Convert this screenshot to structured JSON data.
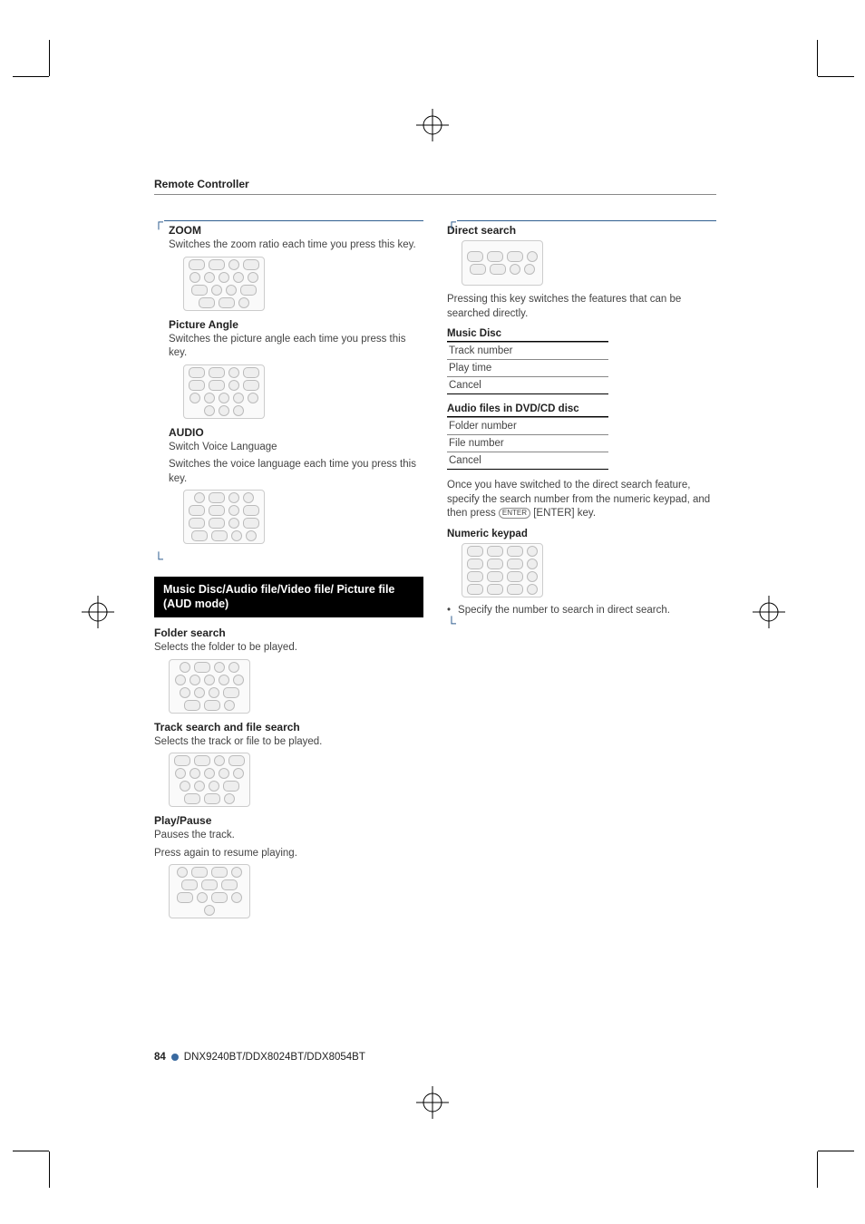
{
  "header": {
    "title": "Remote Controller"
  },
  "left": {
    "zoom": {
      "heading": "ZOOM",
      "desc": "Switches the zoom ratio each time you press this key."
    },
    "pictureAngle": {
      "heading": "Picture Angle",
      "desc": "Switches the picture angle each time you press this key."
    },
    "audio": {
      "heading": "AUDIO",
      "sub": "Switch Voice Language",
      "desc": "Switches the voice language each time you press this key."
    },
    "block": {
      "title": "Music Disc/Audio file/Video file/ Picture file (AUD mode)"
    },
    "folderSearch": {
      "heading": "Folder search",
      "desc": "Selects the folder to be played."
    },
    "trackSearch": {
      "heading": "Track search and file search",
      "desc": "Selects the track or file to be played."
    },
    "playPause": {
      "heading": "Play/Pause",
      "line1": "Pauses the track.",
      "line2": "Press again to resume playing."
    }
  },
  "right": {
    "directSearch": {
      "heading": "Direct search",
      "desc": "Pressing this key switches the features that can be searched directly."
    },
    "musicDisc": {
      "heading": "Music Disc",
      "rows": [
        "Track number",
        "Play time",
        "Cancel"
      ]
    },
    "audioFiles": {
      "heading": "Audio files in DVD/CD disc",
      "rows": [
        "Folder number",
        "File number",
        "Cancel"
      ]
    },
    "afterSwitch": {
      "line1": "Once you have switched to the direct search feature, specify the search number from the numeric keypad, and then press ",
      "enterBtn": "ENTER",
      "line2": " [ENTER] key."
    },
    "numericKeypad": {
      "heading": "Numeric keypad",
      "bullet": "Specify the number to search in direct search."
    }
  },
  "footer": {
    "page": "84",
    "models": "DNX9240BT/DDX8024BT/DDX8054BT"
  }
}
